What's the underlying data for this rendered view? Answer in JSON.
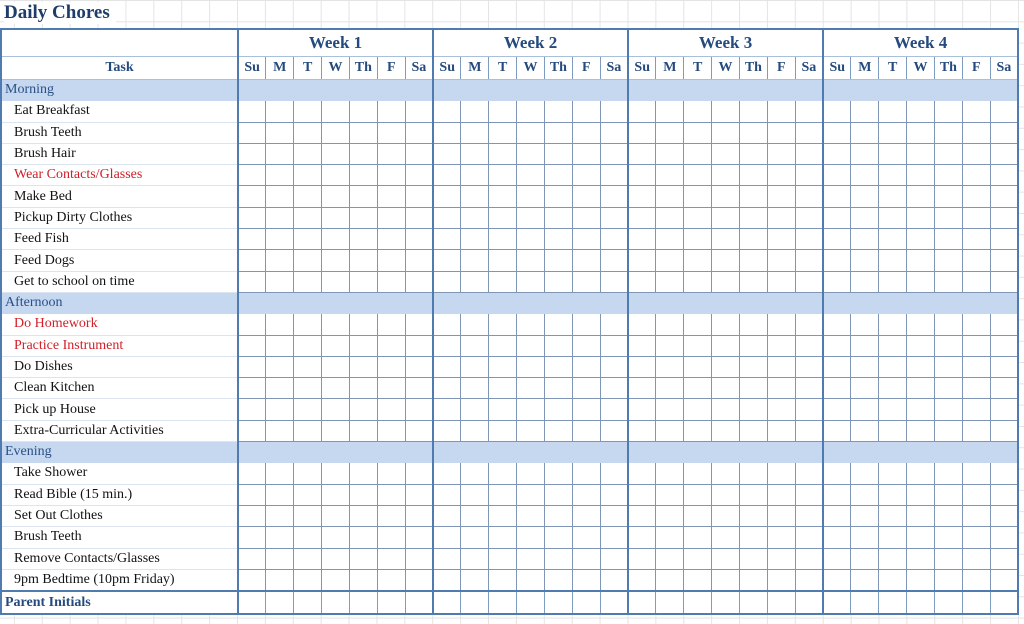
{
  "title": "Daily Chores",
  "task_header": "Task",
  "weeks": [
    "Week 1",
    "Week 2",
    "Week 3",
    "Week 4"
  ],
  "days": [
    "Su",
    "M",
    "T",
    "W",
    "Th",
    "F",
    "Sa"
  ],
  "colors": {
    "title": "#1f3d6b",
    "header_text": "#254a7d",
    "section_fill": "#c5d8ef",
    "section_text": "#2a4f86",
    "highlight_task": "#d0202a",
    "border": "#4f7bb0"
  },
  "sections": [
    {
      "name": "Morning",
      "tasks": [
        {
          "label": "Eat Breakfast",
          "highlight": false
        },
        {
          "label": "Brush Teeth",
          "highlight": false
        },
        {
          "label": "Brush Hair",
          "highlight": false
        },
        {
          "label": "Wear Contacts/Glasses",
          "highlight": true
        },
        {
          "label": "Make Bed",
          "highlight": false
        },
        {
          "label": "Pickup Dirty Clothes",
          "highlight": false
        },
        {
          "label": "Feed Fish",
          "highlight": false
        },
        {
          "label": "Feed Dogs",
          "highlight": false
        },
        {
          "label": "Get to school on time",
          "highlight": false
        }
      ]
    },
    {
      "name": "Afternoon",
      "tasks": [
        {
          "label": "Do Homework",
          "highlight": true
        },
        {
          "label": "Practice Instrument",
          "highlight": true
        },
        {
          "label": "Do Dishes",
          "highlight": false
        },
        {
          "label": "Clean Kitchen",
          "highlight": false
        },
        {
          "label": "Pick up House",
          "highlight": false
        },
        {
          "label": "Extra-Curricular Activities",
          "highlight": false
        }
      ]
    },
    {
      "name": "Evening",
      "tasks": [
        {
          "label": "Take Shower",
          "highlight": false
        },
        {
          "label": "Read Bible (15 min.)",
          "highlight": false
        },
        {
          "label": "Set Out Clothes",
          "highlight": false
        },
        {
          "label": "Brush Teeth",
          "highlight": false
        },
        {
          "label": "Remove Contacts/Glasses",
          "highlight": false
        },
        {
          "label": "9pm Bedtime (10pm Friday)",
          "highlight": false
        }
      ]
    }
  ],
  "footer_label": "Parent Initials"
}
